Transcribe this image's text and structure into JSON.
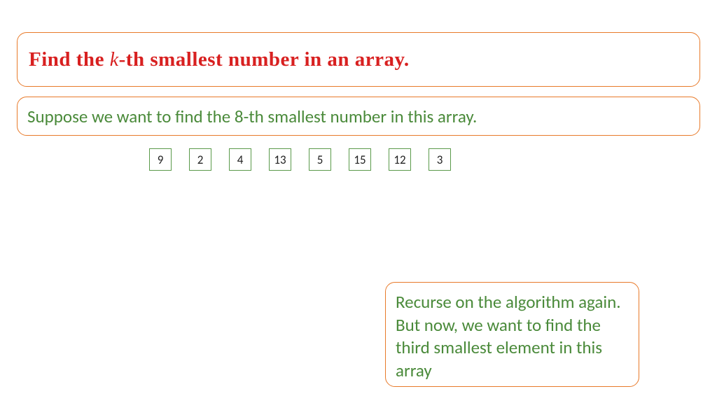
{
  "title": {
    "prefix": "Find the ",
    "variable": "k",
    "suffix": "-th smallest number in an array."
  },
  "subtitle": "Suppose we want to find the 8-th smallest number in this array.",
  "array": [
    "9",
    "2",
    "4",
    "13",
    "5",
    "15",
    "12",
    "3"
  ],
  "note": "Recurse on the algorithm again. But now, we want to find the third smallest element in this array",
  "colors": {
    "border_orange": "#e87a2a",
    "text_red": "#d82020",
    "text_green": "#4a8a3a",
    "cell_border": "#5a9a4a"
  }
}
